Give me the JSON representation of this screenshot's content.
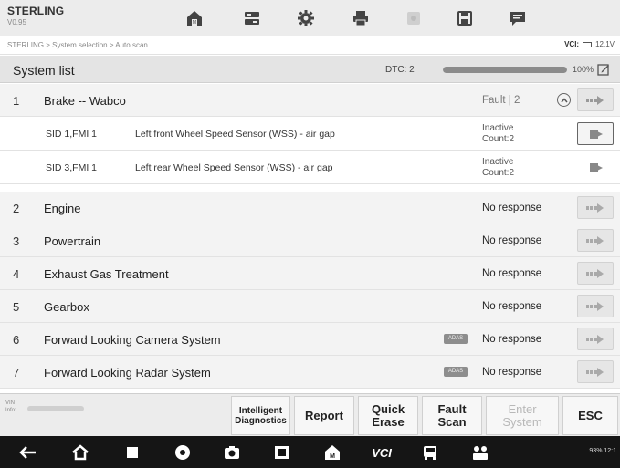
{
  "app": {
    "name": "STERLING",
    "version": "V0.95"
  },
  "toolbar": {
    "icons": [
      "home-icon",
      "vehicle-swap-icon",
      "settings-icon",
      "print-icon",
      "camera-icon",
      "save-icon",
      "message-icon"
    ]
  },
  "breadcrumb": "STERLING > System selection > Auto scan",
  "vci": {
    "label": "VCI:",
    "status": "12.1V"
  },
  "list": {
    "title": "System list",
    "dtc_label": "DTC: 2",
    "progress": 1.0,
    "progress_text": "100%"
  },
  "systems": [
    {
      "num": "1",
      "name": "Brake -- Wabco",
      "status": "Fault | 2",
      "expanded": true,
      "faults": [
        {
          "sid": "SID 1,FMI 1",
          "desc": "Left front Wheel Speed Sensor (WSS) - air gap",
          "state": "Inactive",
          "count": "Count:2"
        },
        {
          "sid": "SID 3,FMI 1",
          "desc": "Left rear Wheel Speed Sensor (WSS) - air gap",
          "state": "Inactive",
          "count": "Count:2"
        }
      ]
    },
    {
      "num": "2",
      "name": "Engine",
      "status": "No response"
    },
    {
      "num": "3",
      "name": "Powertrain",
      "status": "No response"
    },
    {
      "num": "4",
      "name": "Exhaust Gas Treatment",
      "status": "No response"
    },
    {
      "num": "5",
      "name": "Gearbox",
      "status": "No response"
    },
    {
      "num": "6",
      "name": "Forward Looking Camera System",
      "status": "No response",
      "badge": "ADAS"
    },
    {
      "num": "7",
      "name": "Forward Looking Radar System",
      "status": "No response",
      "badge": "ADAS"
    }
  ],
  "bottom": {
    "vin_label": "VIN",
    "info_label": "Info:",
    "buttons": {
      "intelligent": "Intelligent Diagnostics",
      "report": "Report",
      "quick_erase": "Quick Erase",
      "fault_scan": "Fault Scan",
      "enter_system": "Enter System",
      "esc": "ESC"
    }
  },
  "navbar": {
    "icons": [
      "back-icon",
      "home-icon",
      "recent-apps-icon",
      "browser-icon",
      "camera-icon",
      "screen-capture-icon",
      "maxifleet-icon",
      "vci-icon",
      "shop-icon",
      "remote-icon"
    ],
    "status": "93% 12:1"
  },
  "colors": {
    "accent": "#8b8b8b",
    "bar_bg": "#ececec",
    "nav_bg": "#151515"
  }
}
